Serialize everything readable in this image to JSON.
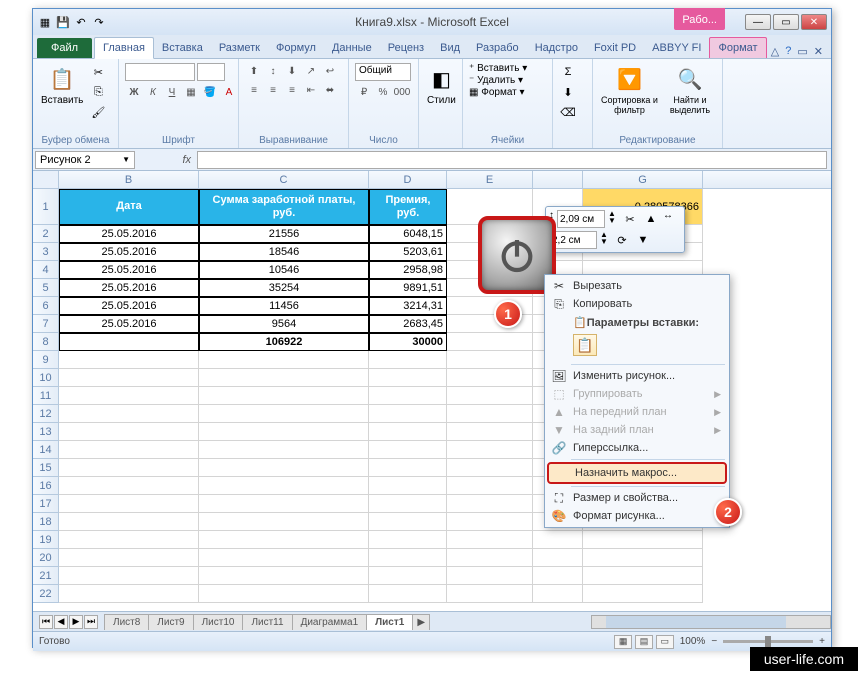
{
  "window": {
    "title": "Книга9.xlsx - Microsoft Excel",
    "tab_extension": "Рабо..."
  },
  "ribbon_tabs": {
    "file": "Файл",
    "home": "Главная",
    "insert": "Вставка",
    "layout": "Разметк",
    "formulas": "Формул",
    "data": "Данные",
    "review": "Реценз",
    "view": "Вид",
    "developer": "Разрабо",
    "addins": "Надстро",
    "foxit": "Foxit PD",
    "abbyy": "ABBYY FI",
    "format": "Формат"
  },
  "ribbon_groups": {
    "clipboard": "Буфер обмена",
    "paste": "Вставить",
    "font": "Шрифт",
    "alignment": "Выравнивание",
    "number": "Число",
    "number_format": "Общий",
    "styles": "Стили",
    "cells": "Ячейки",
    "insert_btn": "Вставить",
    "delete_btn": "Удалить",
    "format_btn": "Формат",
    "editing": "Редактирование",
    "sort": "Сортировка и фильтр",
    "find": "Найти и выделить"
  },
  "name_box": "Рисунок 2",
  "columns": [
    "B",
    "C",
    "D",
    "E",
    "G"
  ],
  "col_widths": {
    "B": 140,
    "C": 170,
    "D": 78,
    "E": 86,
    "F": 50,
    "G": 120
  },
  "headers": {
    "date": "Дата",
    "salary": "Сумма заработной платы, руб.",
    "bonus": "Премия, руб."
  },
  "rows": [
    {
      "n": 2,
      "date": "25.05.2016",
      "salary": "21556",
      "bonus": "6048,15"
    },
    {
      "n": 3,
      "date": "25.05.2016",
      "salary": "18546",
      "bonus": "5203,61"
    },
    {
      "n": 4,
      "date": "25.05.2016",
      "salary": "10546",
      "bonus": "2958,98"
    },
    {
      "n": 5,
      "date": "25.05.2016",
      "salary": "35254",
      "bonus": "9891,51"
    },
    {
      "n": 6,
      "date": "25.05.2016",
      "salary": "11456",
      "bonus": "3214,31"
    },
    {
      "n": 7,
      "date": "25.05.2016",
      "salary": "9564",
      "bonus": "2683,45"
    }
  ],
  "totals": {
    "n": 8,
    "salary": "106922",
    "bonus": "30000"
  },
  "g1_value": "0,280578366",
  "empty_rows": [
    9,
    10,
    11,
    12,
    13,
    14,
    15,
    16,
    17,
    18,
    19,
    20,
    21,
    22
  ],
  "float_toolbar": {
    "width": "2,09 см",
    "height": "2,2 см"
  },
  "context_menu": {
    "cut": "Вырезать",
    "copy": "Копировать",
    "paste_options": "Параметры вставки:",
    "change_picture": "Изменить рисунок...",
    "group": "Группировать",
    "bring_front": "На передний план",
    "send_back": "На задний план",
    "hyperlink": "Гиперссылка...",
    "assign_macro": "Назначить макрос...",
    "size_props": "Размер и свойства...",
    "format_picture": "Формат рисунка..."
  },
  "callouts": {
    "one": "1",
    "two": "2"
  },
  "sheet_tabs": [
    "Лист8",
    "Лист9",
    "Лист10",
    "Лист11",
    "Диаграмма1",
    "Лист1"
  ],
  "active_sheet": "Лист1",
  "status": {
    "ready": "Готово",
    "zoom": "100%"
  },
  "watermark": "user-life.com"
}
